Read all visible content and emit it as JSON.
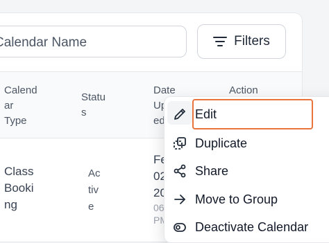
{
  "search": {
    "placeholder": "Calendar Name"
  },
  "filters": {
    "label": "Filters",
    "icon": "filter-lines-icon"
  },
  "table": {
    "headers": {
      "calendar_type": "Calend\nar\nType",
      "status": "Statu\ns",
      "date_updated": "Date\nUp\ned",
      "action": "Action"
    },
    "row": {
      "calendar_type": "Class\nBooki\nng",
      "status": "Ac\ntiv\ne",
      "date_line1": "Fe\n02\n20",
      "date_line2": "06\nPM"
    }
  },
  "menu": {
    "items": [
      {
        "label": "Edit",
        "icon": "pencil-icon"
      },
      {
        "label": "Duplicate",
        "icon": "duplicate-icon"
      },
      {
        "label": "Share",
        "icon": "share-icon"
      },
      {
        "label": "Move to Group",
        "icon": "arrow-right-icon"
      },
      {
        "label": "Deactivate Calendar",
        "icon": "deactivate-icon"
      }
    ],
    "highlight_color": "#e8743b"
  }
}
